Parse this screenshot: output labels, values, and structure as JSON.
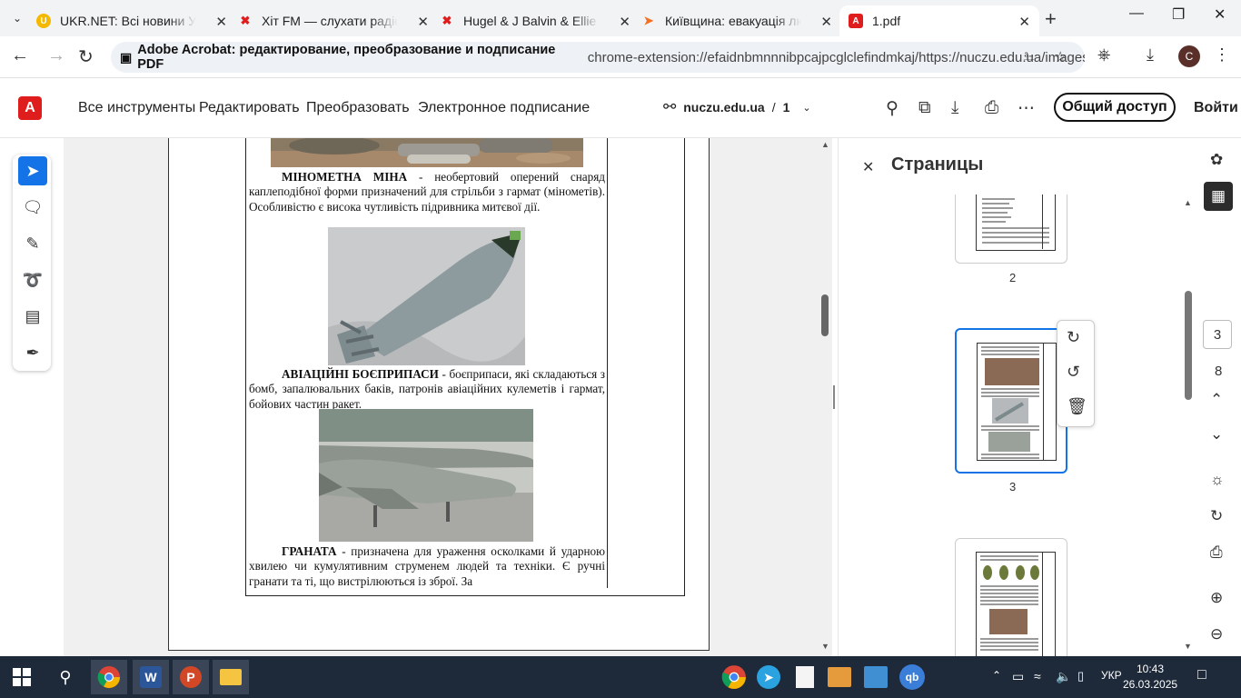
{
  "browser": {
    "tabs": [
      {
        "title": "UKR.NET: Всі новини Україн",
        "icon": "ukrnet-favicon",
        "icon_color": "#f5b800"
      },
      {
        "title": "Хіт FM — слухати радіо онл",
        "icon": "pdf-favicon",
        "icon_color": "#e01d1d"
      },
      {
        "title": "Hugel & J Balvin & Ellie Gou",
        "icon": "pdf-favicon",
        "icon_color": "#e01d1d"
      },
      {
        "title": "Київщина: евакуація людей",
        "icon": "news-favicon",
        "icon_color": "#f27024"
      },
      {
        "title": "1.pdf",
        "icon": "pdf-favicon",
        "icon_color": "#e01d1d"
      }
    ],
    "omnibox_site": "Adobe Acrobat: редактирование, преобразование и подписание PDF",
    "omnibox_url": "chrome-extension://efaidnbmnnnibpcajpcglclefindmkaj/https://nuczu.edu.ua/images/to...",
    "avatar_letter": "C"
  },
  "acrobat": {
    "logo_letter": "A",
    "menu": [
      "Все инструменты",
      "Редактировать",
      "Преобразовать",
      "Электронное подписание"
    ],
    "doc_site": "nuczu.edu.ua",
    "doc_sep": "/",
    "doc_page": "1",
    "share_label": "Общий доступ",
    "login_label": "Войти",
    "accent": "#1473e6"
  },
  "document": {
    "para1_title": "МІНОМЕТНА МІНА",
    "para1_body": " - необертовий оперений снаряд каплеподібної форми призначений для стрільби з гармат (мінометів). Особливістю є висока чутливість підривника митєвої дії.",
    "para2_title": "АВІАЦІЙНІ БОЄПРИПАСИ",
    "para2_body": " - боєприпаси, які складаються з бомб, запалювальних баків, патронів авіаційних кулеметів і гармат, бойових частин ракет.",
    "para3_title": "ГРАНАТА",
    "para3_body": " - призначена для ураження осколками й ударною хвилею чи кумулятивним струменем людей та техніки. Є ручні гранати та ті, що вистрілюються із зброї. За"
  },
  "pages_panel": {
    "title": "Страницы",
    "thumbs": [
      {
        "label": "2"
      },
      {
        "label": "3"
      },
      {
        "label": ""
      }
    ]
  },
  "right_rail": {
    "current_page": "3",
    "total_pages": "8"
  },
  "taskbar": {
    "lang": "УКР",
    "time": "10:43",
    "date": "26.03.2025"
  }
}
